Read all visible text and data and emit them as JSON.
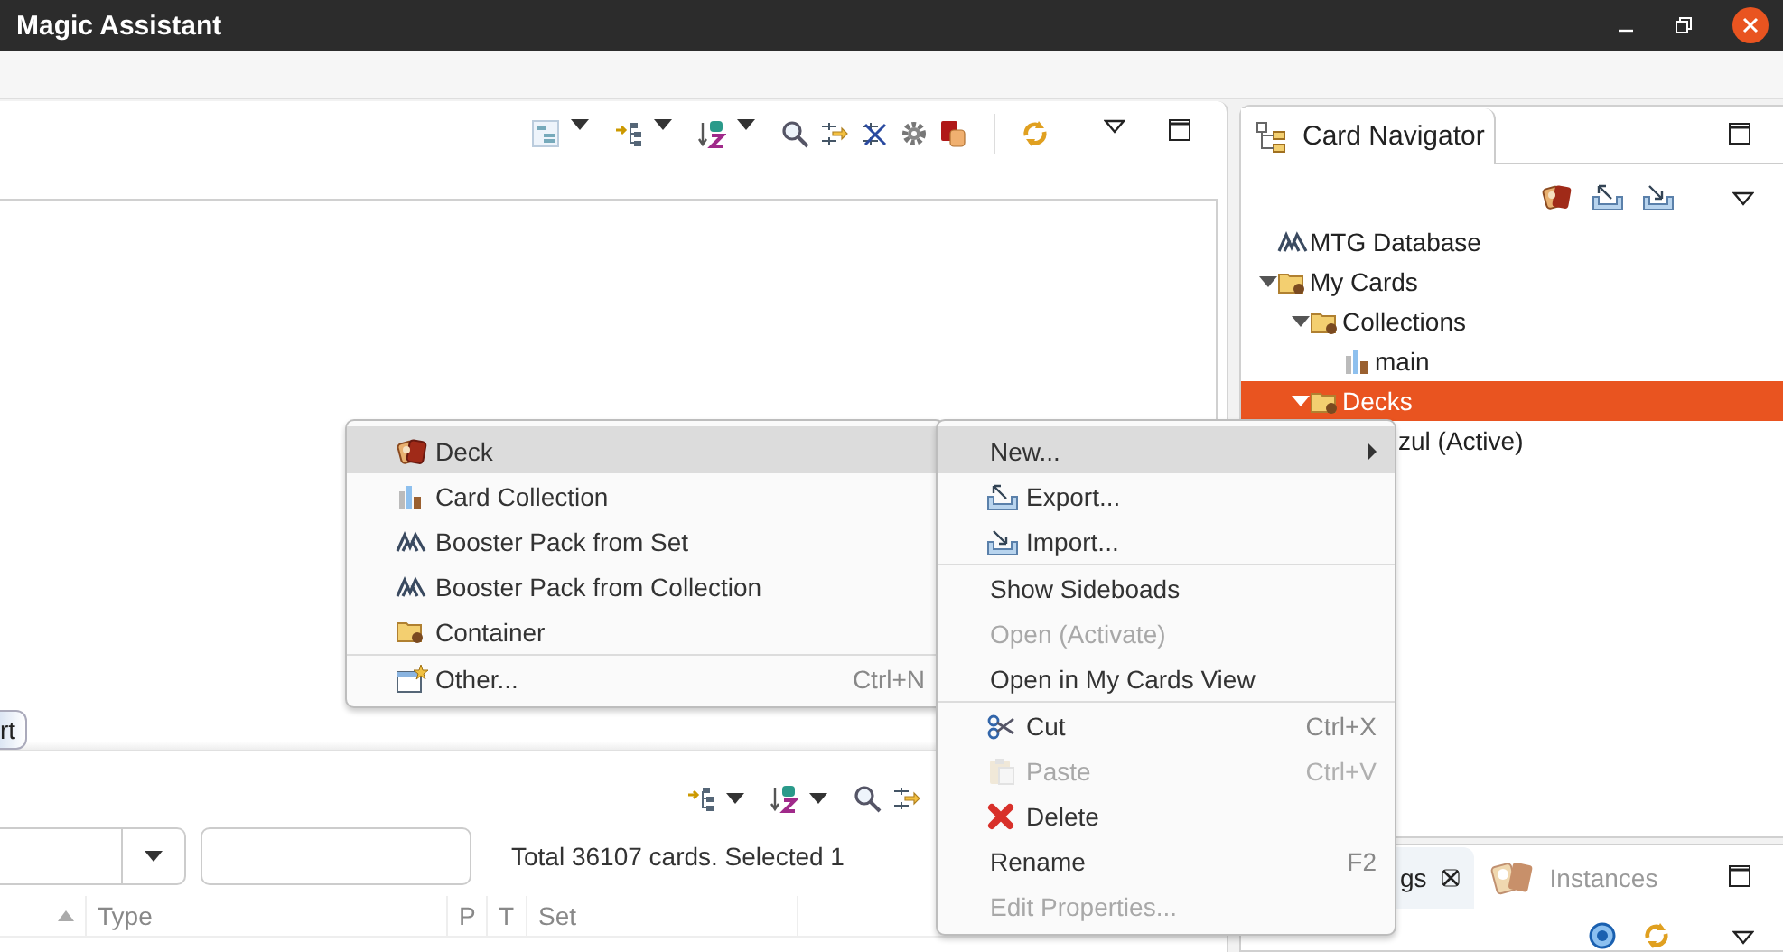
{
  "window": {
    "title": "Magic Assistant"
  },
  "editor": {
    "tab_label": "rt"
  },
  "card_list": {
    "summary": "Total 36107 cards. Selected 1",
    "columns": [
      {
        "label": "Type"
      },
      {
        "label": "P"
      },
      {
        "label": "T"
      },
      {
        "label": "Set"
      }
    ]
  },
  "navigator": {
    "title": "Card Navigator",
    "tree": [
      {
        "label": "MTG Database",
        "kind": "database",
        "selected": false
      },
      {
        "label": "My Cards",
        "kind": "folder",
        "expanded": true,
        "selected": false,
        "children": [
          {
            "label": "Collections",
            "kind": "folder",
            "expanded": true,
            "selected": false,
            "children": [
              {
                "label": "main",
                "kind": "collection",
                "selected": false
              }
            ]
          },
          {
            "label": "Decks",
            "kind": "folder",
            "expanded": true,
            "selected": true,
            "children": [
              {
                "label": "zul (Active)",
                "selected": false
              }
            ]
          }
        ]
      }
    ]
  },
  "bottom_tabs": [
    {
      "label": "gs",
      "closable": true,
      "selected": true
    },
    {
      "label": "Instances",
      "kind": "cards",
      "closable": false,
      "selected": false
    }
  ],
  "context_menu": {
    "groups": [
      [
        {
          "label": "New...",
          "kind": "plain",
          "submenu": true,
          "selected": true,
          "disabled": false
        },
        {
          "label": "Export...",
          "kind": "export",
          "selected": false,
          "disabled": false
        },
        {
          "label": "Import...",
          "kind": "import",
          "selected": false,
          "disabled": false
        }
      ],
      [
        {
          "label": "Show Sideboads",
          "kind": "plain",
          "selected": false,
          "disabled": false
        },
        {
          "label": "Open (Activate)",
          "kind": "plain",
          "selected": false,
          "disabled": true
        },
        {
          "label": "Open in My Cards View",
          "kind": "plain",
          "selected": false,
          "disabled": false
        }
      ],
      [
        {
          "label": "Cut",
          "kind": "cut",
          "shortcut": "Ctrl+X",
          "selected": false,
          "disabled": false
        },
        {
          "label": "Paste",
          "kind": "paste",
          "shortcut": "Ctrl+V",
          "selected": false,
          "disabled": true
        },
        {
          "label": "Delete",
          "kind": "delete",
          "selected": false,
          "disabled": false
        },
        {
          "label": "Rename",
          "kind": "plain",
          "shortcut": "F2",
          "selected": false,
          "disabled": false
        },
        {
          "label": "Edit Properties...",
          "kind": "plain",
          "selected": false,
          "disabled": true
        }
      ]
    ]
  },
  "new_submenu": {
    "groups": [
      [
        {
          "label": "Deck",
          "kind": "deck",
          "selected": true,
          "disabled": false
        },
        {
          "label": "Card Collection",
          "kind": "collection",
          "selected": false,
          "disabled": false
        },
        {
          "label": "Booster Pack from Set",
          "kind": "booster",
          "selected": false,
          "disabled": false
        },
        {
          "label": "Booster Pack from Collection",
          "kind": "booster",
          "selected": false,
          "disabled": false
        },
        {
          "label": "Container",
          "kind": "folder",
          "selected": false,
          "disabled": false
        }
      ],
      [
        {
          "label": "Other...",
          "kind": "wizard",
          "shortcut": "Ctrl+N",
          "selected": false,
          "disabled": false
        }
      ]
    ]
  }
}
